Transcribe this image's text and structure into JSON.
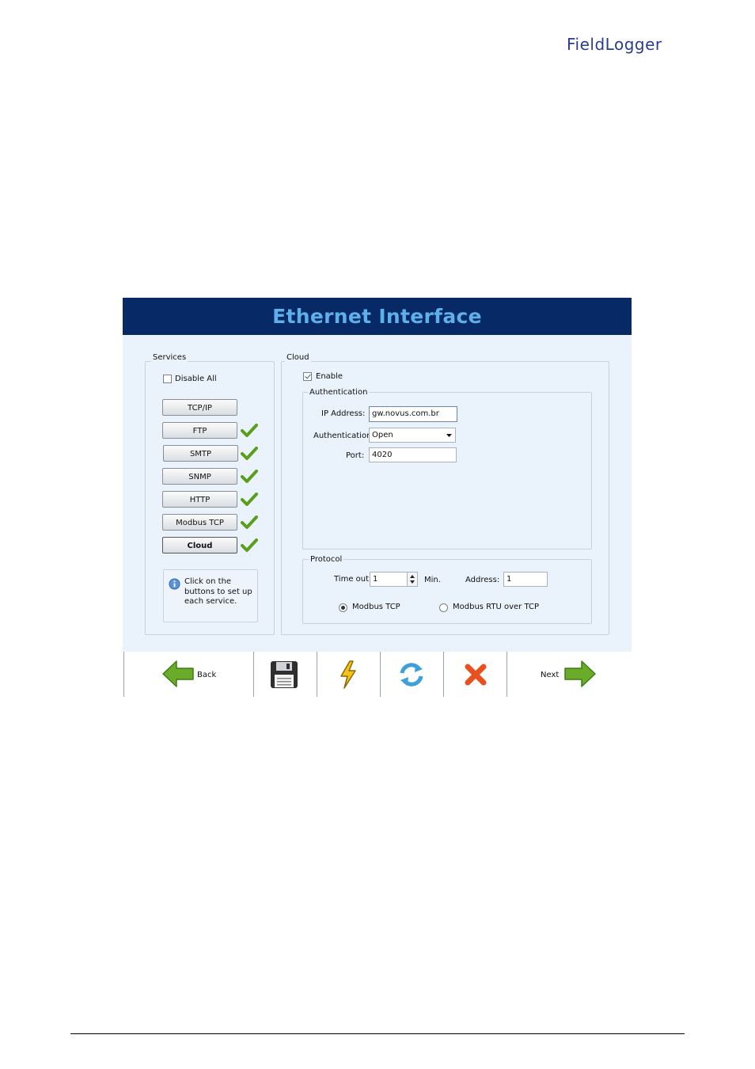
{
  "brand": {
    "logo_text": "FieldLogger"
  },
  "window": {
    "title": "Ethernet Interface"
  },
  "services": {
    "title": "Services",
    "disable_all_label": "Disable All",
    "disable_all_checked": false,
    "items": [
      {
        "label": "TCP/IP",
        "configured": false
      },
      {
        "label": "FTP",
        "configured": true
      },
      {
        "label": "SMTP",
        "configured": true
      },
      {
        "label": "SNMP",
        "configured": true
      },
      {
        "label": "HTTP",
        "configured": true
      },
      {
        "label": "Modbus TCP",
        "configured": true
      },
      {
        "label": "Cloud",
        "configured": true,
        "selected": true
      }
    ],
    "info_text": "Click on the buttons to set up each service."
  },
  "cloud": {
    "title": "Cloud",
    "enable_label": "Enable",
    "enable_checked": true,
    "authentication": {
      "title": "Authentication",
      "ip_label": "IP Address:",
      "ip_value": "gw.novus.com.br",
      "auth_label": "Authentication:",
      "auth_value": "Open",
      "port_label": "Port:",
      "port_value": "4020"
    },
    "protocol": {
      "title": "Protocol",
      "timeout_label": "Time out:",
      "timeout_value": "1",
      "timeout_unit": "Min.",
      "address_label": "Address:",
      "address_value": "1",
      "options": [
        {
          "label": "Modbus TCP",
          "selected": true
        },
        {
          "label": "Modbus RTU over TCP",
          "selected": false
        }
      ]
    }
  },
  "toolbar": {
    "back_label": "Back",
    "next_label": "Next",
    "icons": [
      "back-arrow-icon",
      "save-disk-icon",
      "lightning-icon",
      "refresh-icon",
      "cancel-x-icon",
      "next-arrow-icon"
    ]
  },
  "colors": {
    "title_bar": "#072a66",
    "title_text": "#5fb0ea",
    "panel_bg": "#eaf2fb",
    "check_green": "#5a9e1a",
    "arrow_green": "#6aac2a",
    "cancel_red": "#e8501e"
  }
}
